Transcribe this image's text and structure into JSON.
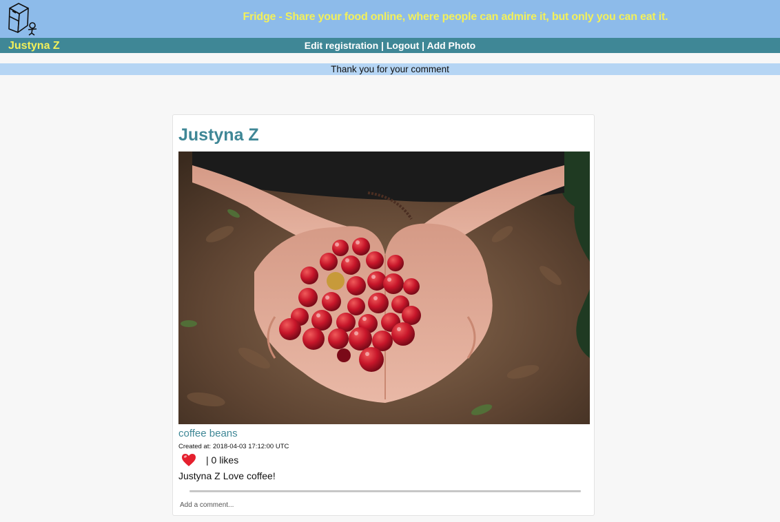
{
  "header": {
    "logo_icon": "fridge-logo-icon",
    "tagline": "Fridge - Share your food online, where people can admire it, but only you can eat it.",
    "colors": {
      "background": "#8dbbea",
      "tagline": "#f3f05a"
    }
  },
  "nav": {
    "user_name": "Justyna Z",
    "edit_registration": "Edit registration",
    "separator": " | ",
    "logout": "Logout",
    "add_photo": "Add Photo",
    "colors": {
      "background": "#3f8796",
      "user": "#f3f05a",
      "links": "#ffffff"
    }
  },
  "flash": {
    "message": "Thank you for your comment",
    "color": "#b5d5f4"
  },
  "post": {
    "author": "Justyna Z",
    "photo_alt": "coffee beans",
    "title": "coffee beans",
    "created_label": "Created at:",
    "created_at": "2018-04-03 17:12:00 UTC",
    "like_icon": "heart-icon",
    "likes_text": "| 0 likes",
    "comments": [
      {
        "author": "Justyna Z",
        "text": "Love coffee!"
      }
    ],
    "comment_placeholder": "Add a comment...",
    "accent_color": "#3f8796"
  }
}
